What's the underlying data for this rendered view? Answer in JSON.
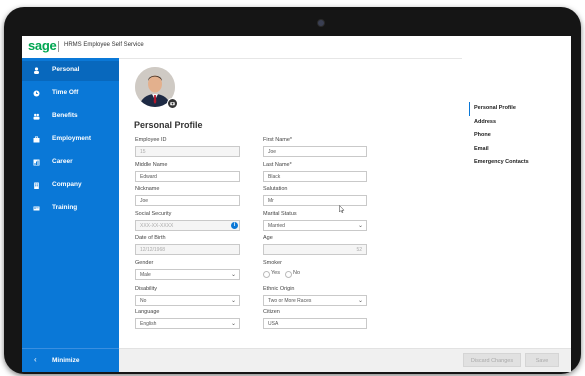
{
  "header": {
    "logo": "sage",
    "title": "HRMS Employee Self Service"
  },
  "sidebar": {
    "items": [
      {
        "label": "Personal",
        "icon": "person-icon"
      },
      {
        "label": "Time Off",
        "icon": "clock-icon"
      },
      {
        "label": "Benefits",
        "icon": "people-icon"
      },
      {
        "label": "Employment",
        "icon": "briefcase-icon"
      },
      {
        "label": "Career",
        "icon": "chart-icon"
      },
      {
        "label": "Company",
        "icon": "building-icon"
      },
      {
        "label": "Training",
        "icon": "training-icon"
      }
    ],
    "minimize_label": "Minimize"
  },
  "profile": {
    "title": "Personal Profile",
    "fields": {
      "employee_id": {
        "label": "Employee ID",
        "value": "15"
      },
      "first_name": {
        "label": "First Name*",
        "value": "Joe"
      },
      "middle_name": {
        "label": "Middle Name",
        "value": "Edward"
      },
      "last_name": {
        "label": "Last Name*",
        "value": "Black"
      },
      "nickname": {
        "label": "Nickname",
        "value": "Joe"
      },
      "salutation": {
        "label": "Salutation",
        "value": "Mr"
      },
      "social_security": {
        "label": "Social Security",
        "value": "XXX-XX-XXXX"
      },
      "marital_status": {
        "label": "Marital Status",
        "value": "Married"
      },
      "dob": {
        "label": "Date of Birth",
        "value": "12/12/1968"
      },
      "age": {
        "label": "Age",
        "value": "52"
      },
      "gender": {
        "label": "Gender",
        "value": "Male"
      },
      "smoker": {
        "label": "Smoker",
        "yes": "Yes",
        "no": "No"
      },
      "disability": {
        "label": "Disability",
        "value": "No"
      },
      "ethnic_origin": {
        "label": "Ethnic Origin",
        "value": "Two or More Races"
      },
      "language": {
        "label": "Language",
        "value": "English"
      },
      "citizen": {
        "label": "Citizen",
        "value": "USA"
      }
    }
  },
  "right_nav": [
    "Personal Profile",
    "Address",
    "Phone",
    "Email",
    "Emergency Contacts"
  ],
  "footer": {
    "discard": "Discard Changes",
    "save": "Save"
  },
  "colors": {
    "sidebar": "#0a78d7",
    "brand": "#00a651"
  }
}
